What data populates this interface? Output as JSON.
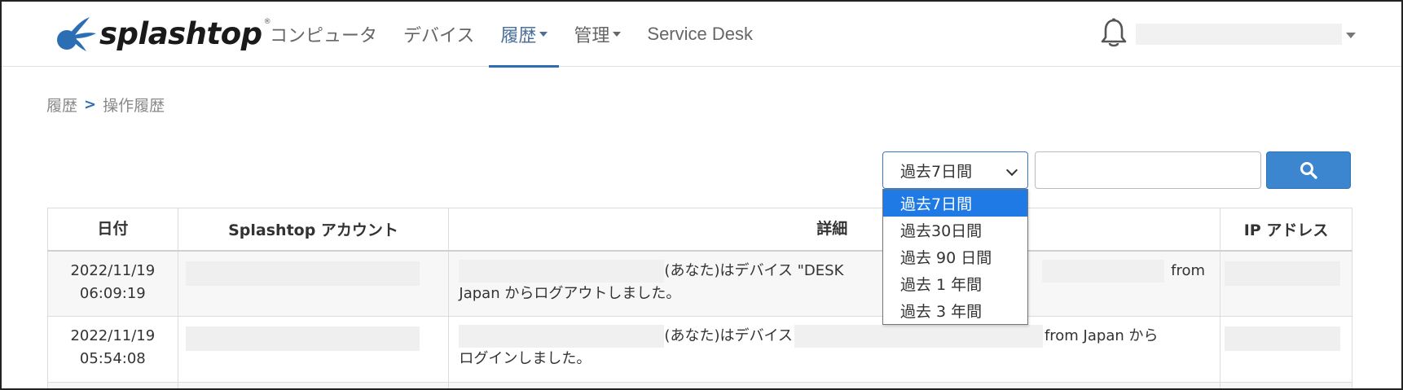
{
  "header": {
    "logo_text": "splashtop",
    "logo_reg": "®",
    "nav": [
      {
        "label": "コンピュータ",
        "has_caret": false
      },
      {
        "label": "デバイス",
        "has_caret": false
      },
      {
        "label": "履歴",
        "has_caret": true,
        "active": true
      },
      {
        "label": "管理",
        "has_caret": true
      },
      {
        "label": "Service Desk",
        "has_caret": false
      }
    ],
    "bell_icon": "bell-icon",
    "accent_color": "#2c6eb4"
  },
  "breadcrumb": {
    "parent": "履歴",
    "separator": ">",
    "current": "操作履歴"
  },
  "filters": {
    "period_selected": "過去7日間",
    "period_options": [
      "過去7日間",
      "過去30日間",
      "過去 90 日間",
      "過去 1 年間",
      "過去 3 年間"
    ],
    "search_value": "",
    "search_button_icon": "search-icon"
  },
  "table": {
    "headers": [
      "日付",
      "Splashtop アカウント",
      "詳細",
      "IP アドレス"
    ],
    "rows": [
      {
        "date": "2022/11/19",
        "time": "06:09:19",
        "detail_a": "(あなた)はデバイス \"DESK",
        "detail_b": "from",
        "detail_line2": "Japan からログアウトしました。"
      },
      {
        "date": "2022/11/19",
        "time": "05:54:08",
        "detail_a": "(あなた)はデバイス",
        "detail_b": "from Japan から",
        "detail_line2": "ログインしました。"
      }
    ]
  }
}
